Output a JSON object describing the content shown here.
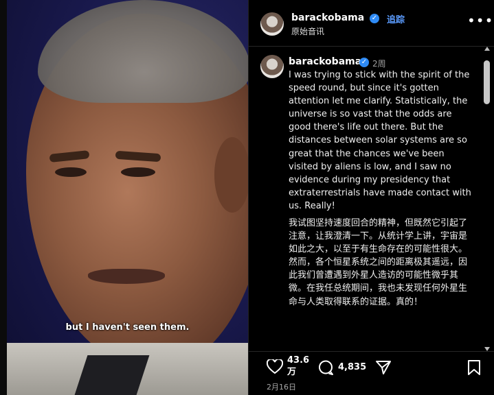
{
  "video": {
    "caption": "but I haven't seen them."
  },
  "header": {
    "username": "barackobama",
    "follow_label": "追踪",
    "audio_label": "原始音讯",
    "more_icon": "more-horizontal-icon"
  },
  "comment": {
    "username": "barackobama",
    "time_ago": "2周",
    "text_en": "I was trying to stick with the spirit of the speed round, but since it's gotten attention let me clarify. Statistically, the universe is so vast that the odds are good there's life out there. But the distances between solar systems are so great that the chances we've been visited by aliens is low, and I saw no evidence during my presidency that extraterrestrials have made contact with us. Really!",
    "text_cn": "我试图坚持速度回合的精神，但既然它引起了注意，让我澄清一下。从统计学上讲，宇宙是如此之大，以至于有生命存在的可能性很大。然而，各个恒星系统之间的距离极其遥远，因此我们曾遭遇到外星人造访的可能性微乎其微。在我任总统期间，我也未发现任何外星生命与人类取得联系的证据。真的！"
  },
  "actions": {
    "likes": "43.6",
    "likes_unit": "万",
    "comments": "4,835",
    "like_icon": "heart-icon",
    "comment_icon": "comment-bubble-icon",
    "share_icon": "send-paper-plane-icon",
    "save_icon": "bookmark-icon"
  },
  "post_date": "2月16日",
  "colors": {
    "verified_badge": "#2f8bf5",
    "follow_link": "#5b9cff",
    "panel_bg": "#000000"
  }
}
